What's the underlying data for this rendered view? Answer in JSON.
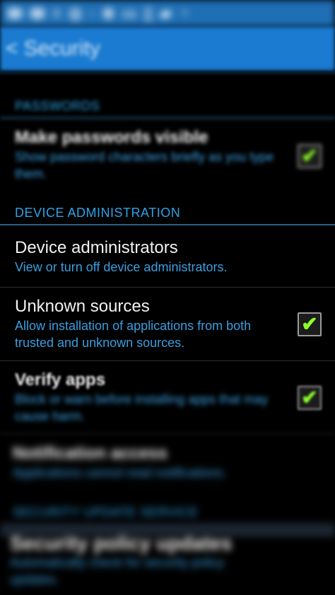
{
  "status_bar": {
    "text": "≡ ◎ ◦ ⊕  ▭ ▯ ▰ ◔"
  },
  "action_bar": {
    "back_glyph": "<",
    "title": "Security"
  },
  "sections": {
    "passwords": {
      "header": "PASSWORDS"
    },
    "device_admin": {
      "header": "DEVICE ADMINISTRATION"
    },
    "security_update": {
      "header": "SECURITY UPDATE SERVICE"
    }
  },
  "rows": {
    "make_passwords_visible": {
      "title": "Make passwords visible",
      "subtitle": "Show password characters briefly as you type them.",
      "checked": true
    },
    "device_administrators": {
      "title": "Device administrators",
      "subtitle": "View or turn off device administrators."
    },
    "unknown_sources": {
      "title": "Unknown sources",
      "subtitle": "Allow installation of applications from both trusted and unknown sources.",
      "checked": true
    },
    "verify_apps": {
      "title": "Verify apps",
      "subtitle": "Block or warn before installing apps that may cause harm.",
      "checked": true
    },
    "notification_access": {
      "title": "Notification access",
      "subtitle": "Applications cannot read notifications."
    },
    "security_policy_updates": {
      "title": "Security policy updates",
      "subtitle": "Automatically check for security policy updates."
    }
  },
  "icons": {
    "check": "✔"
  }
}
